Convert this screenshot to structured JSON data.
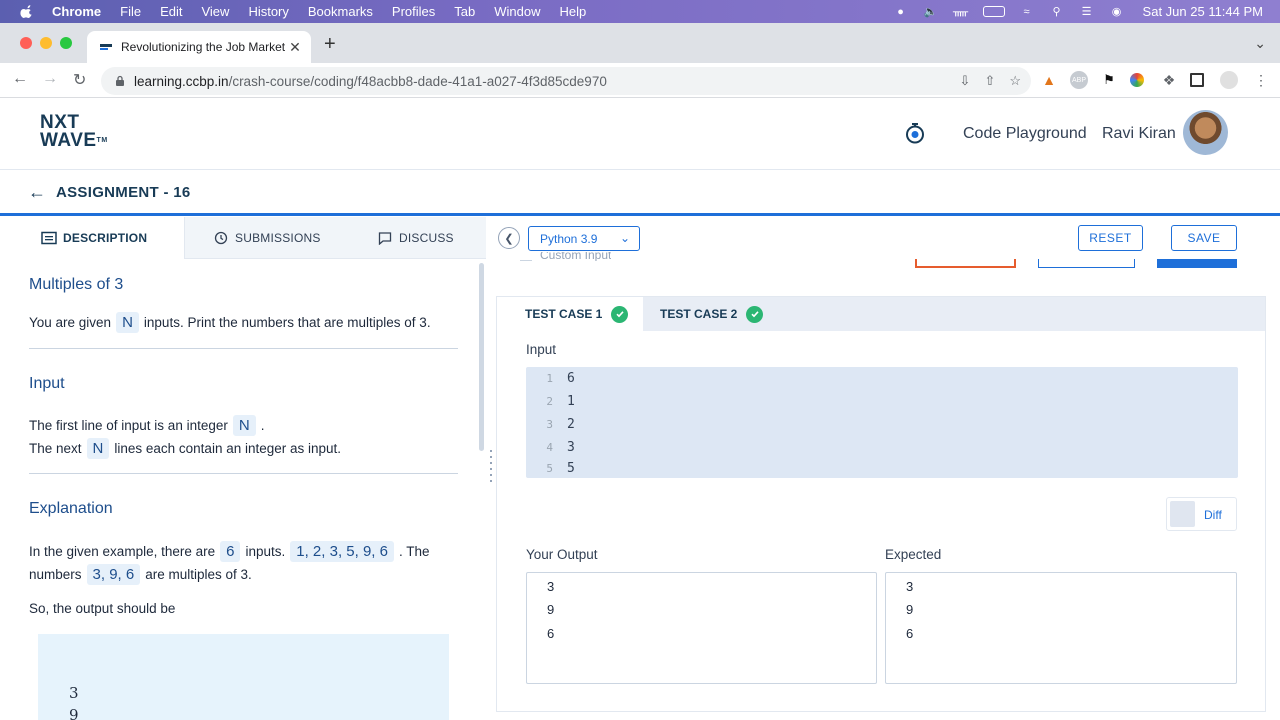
{
  "menubar": {
    "app": "Chrome",
    "items": [
      "File",
      "Edit",
      "View",
      "History",
      "Bookmarks",
      "Profiles",
      "Tab",
      "Window",
      "Help"
    ],
    "clock": "Sat Jun 25  11:44 PM"
  },
  "browser": {
    "tab_title": "Revolutionizing the Job Market",
    "url_host": "learning.ccbp.in",
    "url_path": "/crash-course/coding/f48acbb8-dade-41a1-a027-4f3d85cde970"
  },
  "header": {
    "logo_line1": "NXT",
    "logo_line2": "WAVE",
    "logo_tm": "TM",
    "playground": "Code Playground",
    "user_name": "Ravi Kiran"
  },
  "assignment": {
    "title": "ASSIGNMENT - 16"
  },
  "left_tabs": {
    "description": "DESCRIPTION",
    "submissions": "SUBMISSIONS",
    "discuss": "DISCUSS"
  },
  "problem": {
    "title": "Multiples of 3",
    "intro_a": "You are given",
    "intro_n": "N",
    "intro_b": "inputs. Print the numbers that are multiples of 3.",
    "input_heading": "Input",
    "input_line1_a": "The first line of input is an integer",
    "input_line1_n": "N",
    "input_line1_b": ".",
    "input_line2_a": "The next",
    "input_line2_n": "N",
    "input_line2_b": "lines each contain an integer as input.",
    "explanation_heading": "Explanation",
    "exp_a": "In the given example, there are",
    "exp_count": "6",
    "exp_b": "inputs.",
    "exp_list": "1, 2, 3, 5, 9, 6",
    "exp_c": ". The",
    "exp_d": "numbers",
    "exp_multiples": "3, 9, 6",
    "exp_e": "are multiples of 3.",
    "output_intro": "So, the output should be",
    "output_lines": [
      "3",
      "9"
    ]
  },
  "editor_bar": {
    "language": "Python 3.9",
    "reset": "RESET",
    "save": "SAVE",
    "custom_input": "Custom Input"
  },
  "console": {
    "tabs": [
      "TEST CASE 1",
      "TEST CASE 2"
    ],
    "input_label": "Input",
    "input_lines": [
      {
        "n": "1",
        "v": "6"
      },
      {
        "n": "2",
        "v": "1"
      },
      {
        "n": "3",
        "v": "2"
      },
      {
        "n": "4",
        "v": "3"
      },
      {
        "n": "5",
        "v": "5"
      }
    ],
    "diff": "Diff",
    "your_output_label": "Your Output",
    "expected_label": "Expected",
    "your_output": [
      "3",
      "9",
      "6"
    ],
    "expected": [
      "3",
      "9",
      "6"
    ]
  },
  "colors": {
    "brand_blue": "#1e6fd9",
    "navy": "#183b56",
    "success": "#2bb673"
  }
}
